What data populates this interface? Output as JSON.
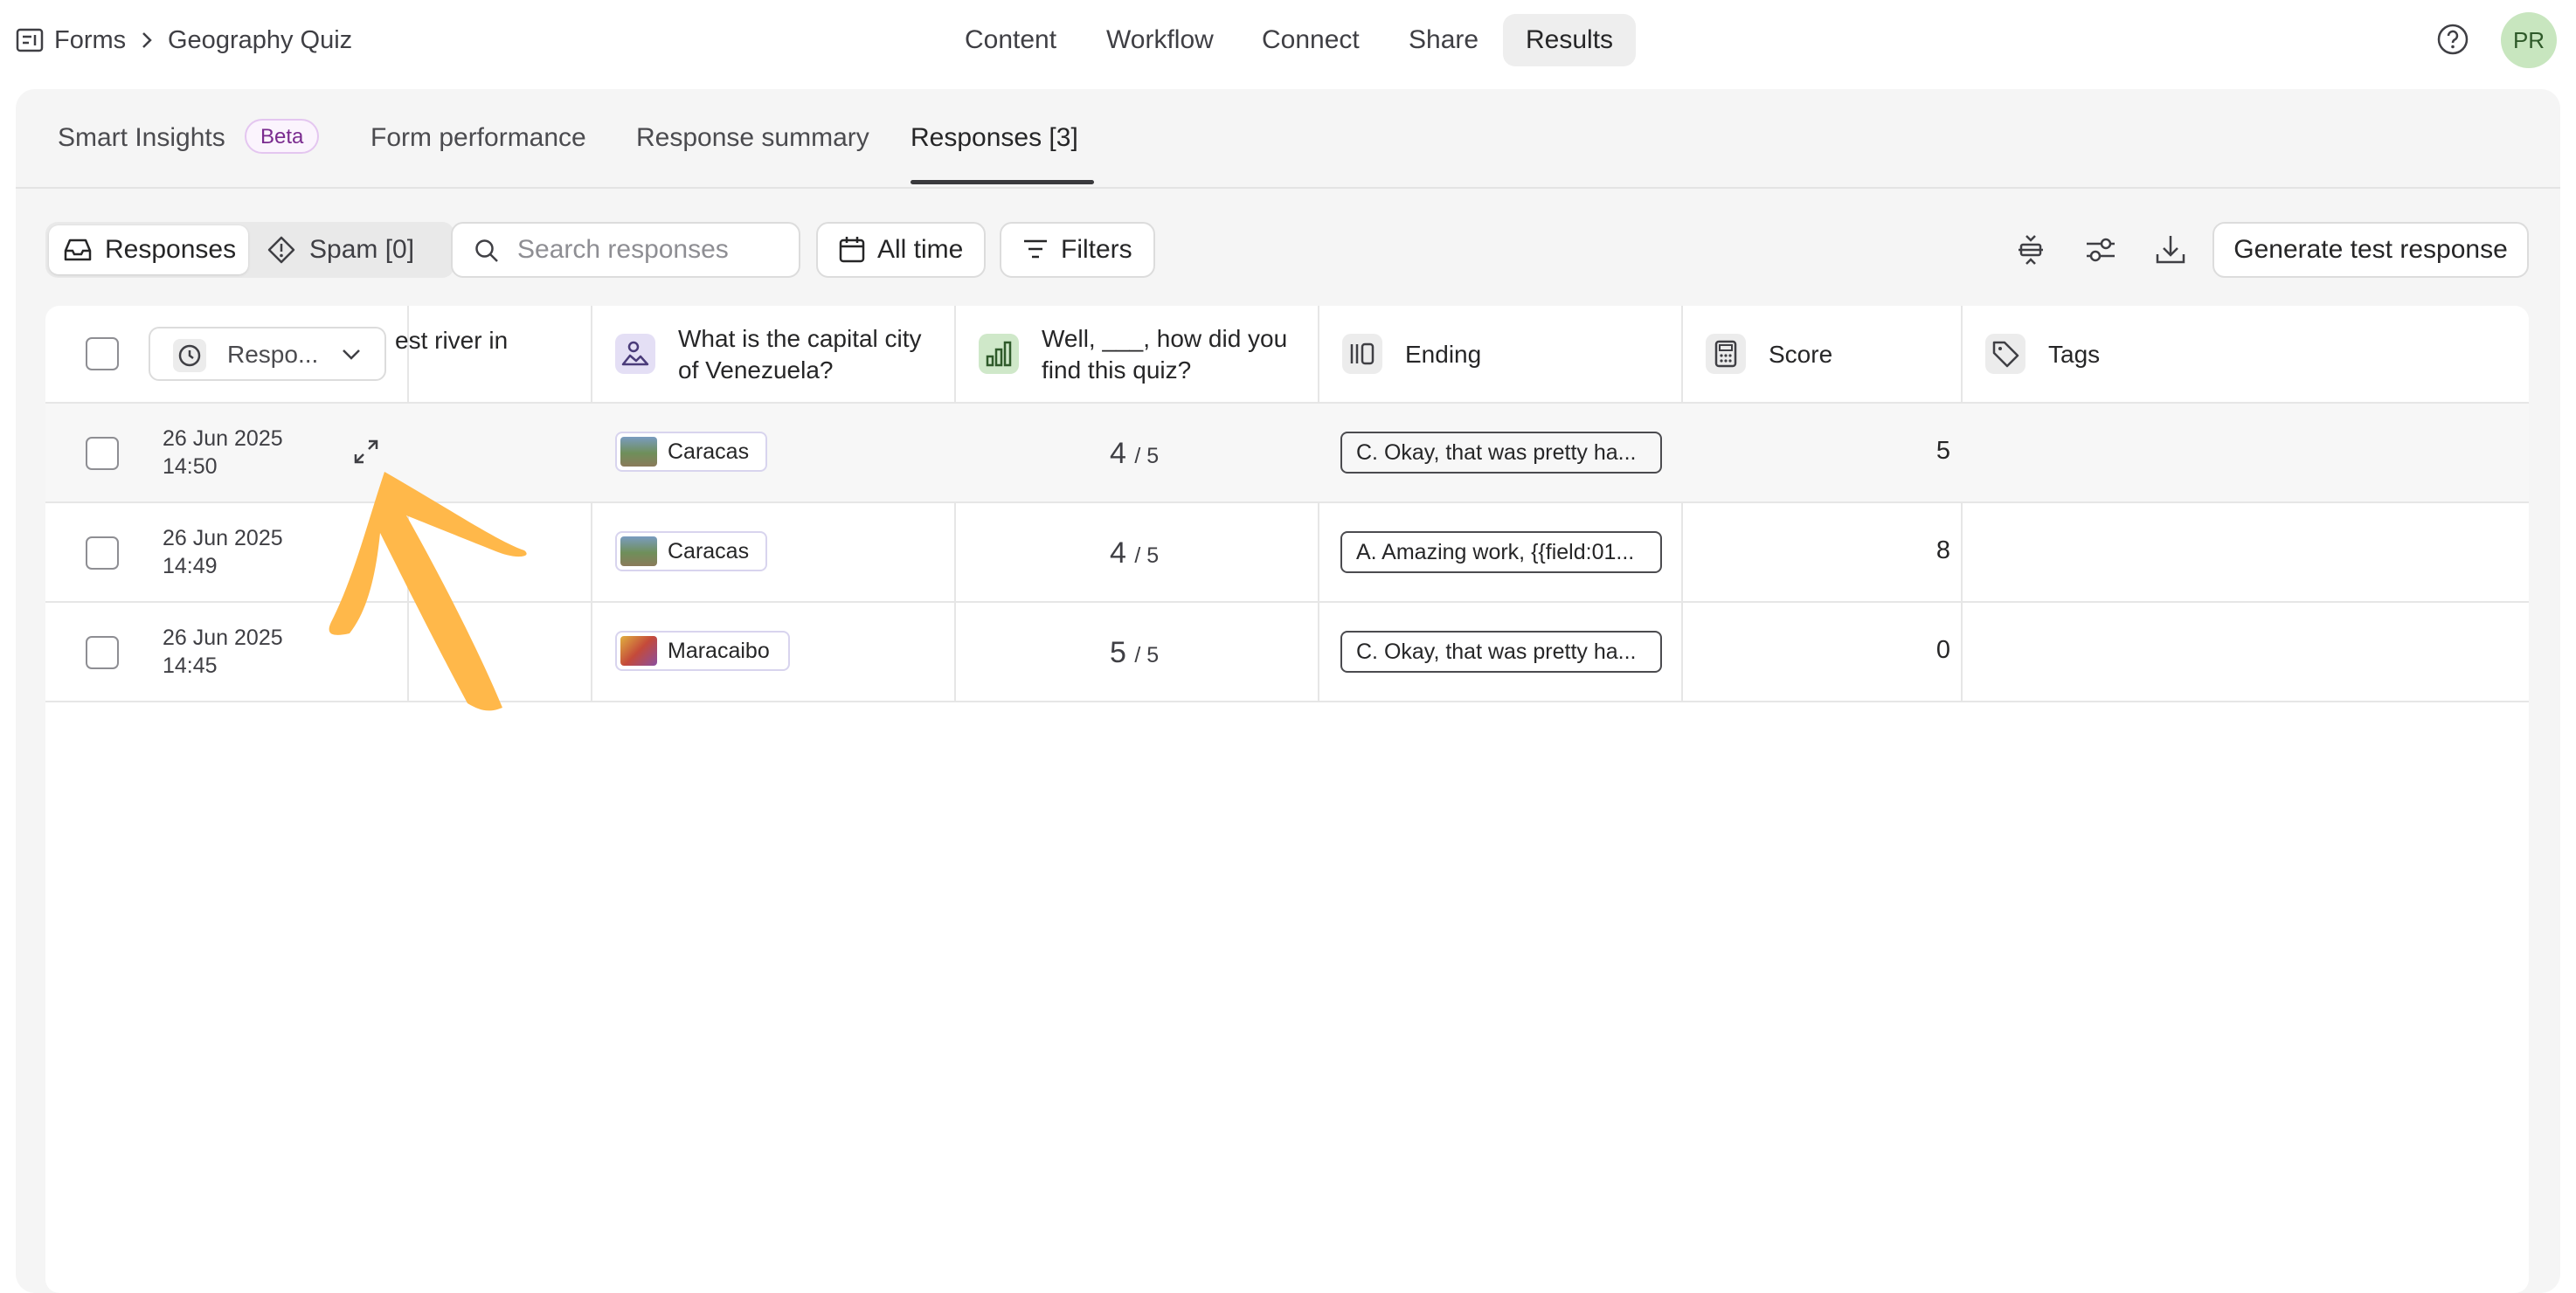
{
  "breadcrumb": {
    "root": "Forms",
    "current": "Geography Quiz"
  },
  "nav": {
    "tabs": [
      "Content",
      "Workflow",
      "Connect",
      "Share",
      "Results"
    ],
    "active": "Results"
  },
  "user": {
    "initials": "PR"
  },
  "subtabs": {
    "smart_insights": "Smart Insights",
    "beta": "Beta",
    "form_performance": "Form performance",
    "response_summary": "Response summary",
    "responses": "Responses [3]"
  },
  "toolbar": {
    "responses": "Responses",
    "spam": "Spam [0]",
    "search_placeholder": "Search responses",
    "all_time": "All time",
    "filters": "Filters",
    "generate": "Generate test response"
  },
  "table": {
    "columns": {
      "sort": "Respo...",
      "river": "est river in",
      "capital": "What is the capital city of Venezuela?",
      "rating": "Well, ___, how did you find this quiz?",
      "ending": "Ending",
      "score": "Score",
      "tags": "Tags"
    },
    "rows": [
      {
        "date": "26 Jun 2025",
        "time": "14:50",
        "capital": "Caracas",
        "rating": "4",
        "rating_max": "/ 5",
        "ending": "C. Okay, that was pretty ha...",
        "score": "5"
      },
      {
        "date": "26 Jun 2025",
        "time": "14:49",
        "capital": "Caracas",
        "rating": "4",
        "rating_max": "/ 5",
        "ending": "A. Amazing work, {{field:01...",
        "score": "8"
      },
      {
        "date": "26 Jun 2025",
        "time": "14:45",
        "capital": "Maracaibo",
        "rating": "5",
        "rating_max": "/ 5",
        "ending": "C. Okay, that was pretty ha...",
        "score": "0"
      }
    ]
  },
  "colors": {
    "arrow": "#ffb84a",
    "avatar_bg": "#c8e6bf",
    "beta_text": "#7a2b8f",
    "capital_icon_bg": "#e4dff5",
    "rating_icon_bg": "#cfe8c9"
  },
  "icons": [
    "form-icon",
    "chevron-right-icon",
    "help-icon",
    "inbox-icon",
    "spam-icon",
    "search-icon",
    "calendar-icon",
    "filter-icon",
    "row-height-icon",
    "settings-sliders-icon",
    "download-icon",
    "clock-icon",
    "chevron-down-icon",
    "picture-choice-icon",
    "rating-icon",
    "ending-icon",
    "calculator-icon",
    "tag-icon",
    "expand-icon",
    "annotation-arrow"
  ]
}
